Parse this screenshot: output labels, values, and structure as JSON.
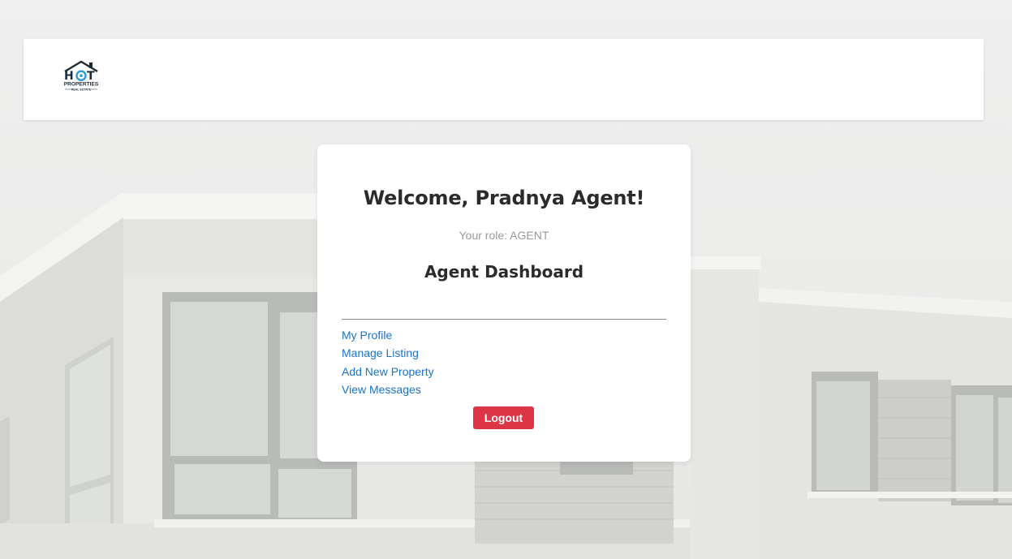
{
  "header": {
    "logo": {
      "text_main": "HOT",
      "text_sub": "PROPERTIES",
      "text_tag": "REAL ESTATE"
    }
  },
  "card": {
    "welcome": "Welcome, Pradnya Agent!",
    "role": "Your role: AGENT",
    "dashboard_title": "Agent Dashboard",
    "menu": [
      {
        "label": "My Profile"
      },
      {
        "label": "Manage Listing"
      },
      {
        "label": "Add New Property"
      },
      {
        "label": "View Messages"
      }
    ],
    "logout_label": "Logout"
  },
  "colors": {
    "link": "#1a73c8",
    "logout": "#dc3545",
    "logo_dark": "#1e2a38",
    "logo_accent": "#2e9bd6"
  }
}
